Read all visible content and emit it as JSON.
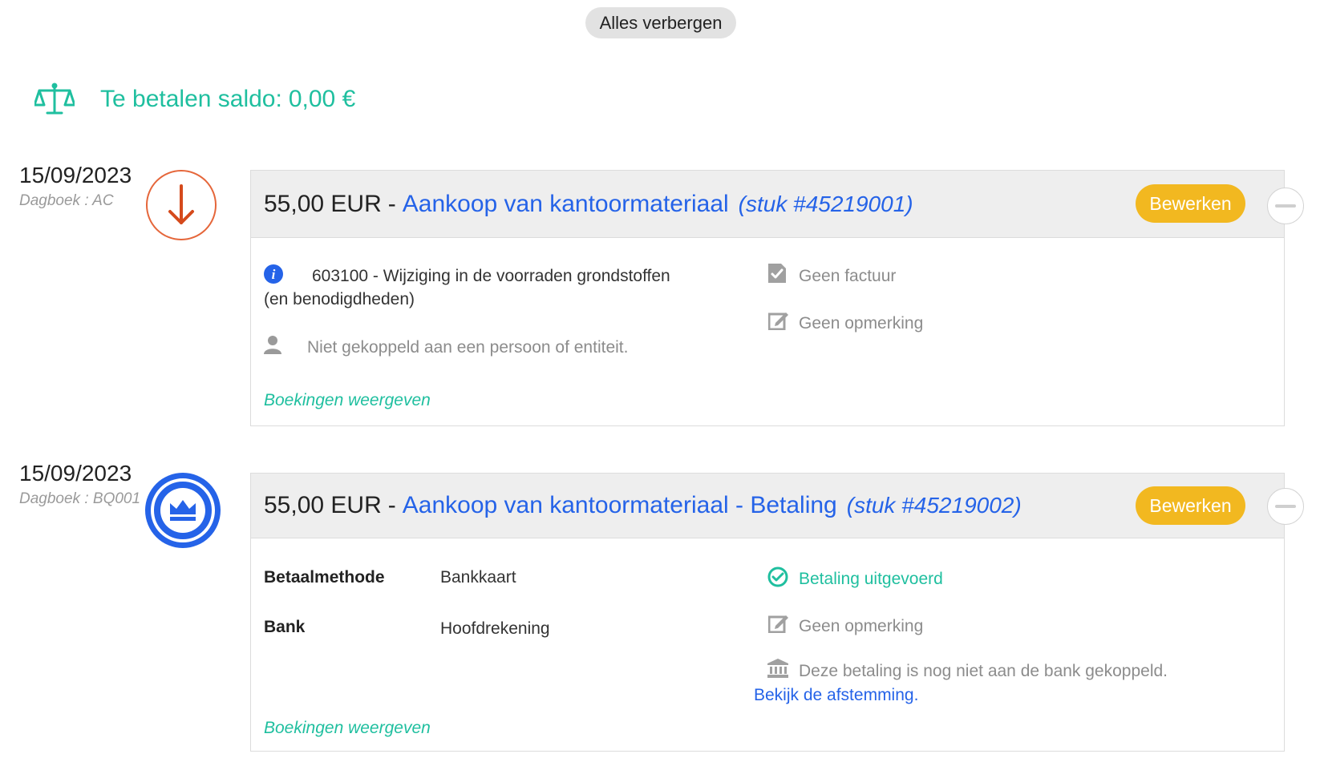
{
  "toolbar": {
    "hide_all_label": "Alles verbergen"
  },
  "balance": {
    "label": "Te betalen saldo:",
    "value": "0,00 €"
  },
  "colors": {
    "teal": "#1fbf9f",
    "blue": "#2563e8",
    "orange": "#e5663a",
    "yellow": "#f2b820"
  },
  "entries": [
    {
      "date": "15/09/2023",
      "journal": "Dagboek : AC",
      "status_icon": "arrow-down-icon",
      "amount": "55,00 EUR",
      "separator": "-",
      "title": "Aankoop van kantoormateriaal",
      "piece": "(stuk #45219001)",
      "edit_label": "Bewerken",
      "account_line1": "603100 - Wijziging in de voorraden grondstoffen",
      "account_line2": "(en benodigdheden)",
      "person": "Niet gekoppeld aan een persoon of entiteit.",
      "invoice": "Geen factuur",
      "remark": "Geen opmerking",
      "show_bookings": "Boekingen weergeven"
    },
    {
      "date": "15/09/2023",
      "journal": "Dagboek : BQ001",
      "status_icon": "crown-icon",
      "amount": "55,00 EUR",
      "separator": "-",
      "title": "Aankoop van kantoormateriaal - Betaling",
      "piece": "(stuk #45219002)",
      "edit_label": "Bewerken",
      "payment_method_label": "Betaalmethode",
      "payment_method_value": "Bankkaart",
      "bank_label": "Bank",
      "bank_value": "Hoofdrekening",
      "payment_status": "Betaling uitgevoerd",
      "remark": "Geen opmerking",
      "bank_note": "Deze betaling is nog niet aan de bank gekoppeld.",
      "reconciliation_link": "Bekijk de afstemming.",
      "show_bookings": "Boekingen weergeven"
    }
  ]
}
